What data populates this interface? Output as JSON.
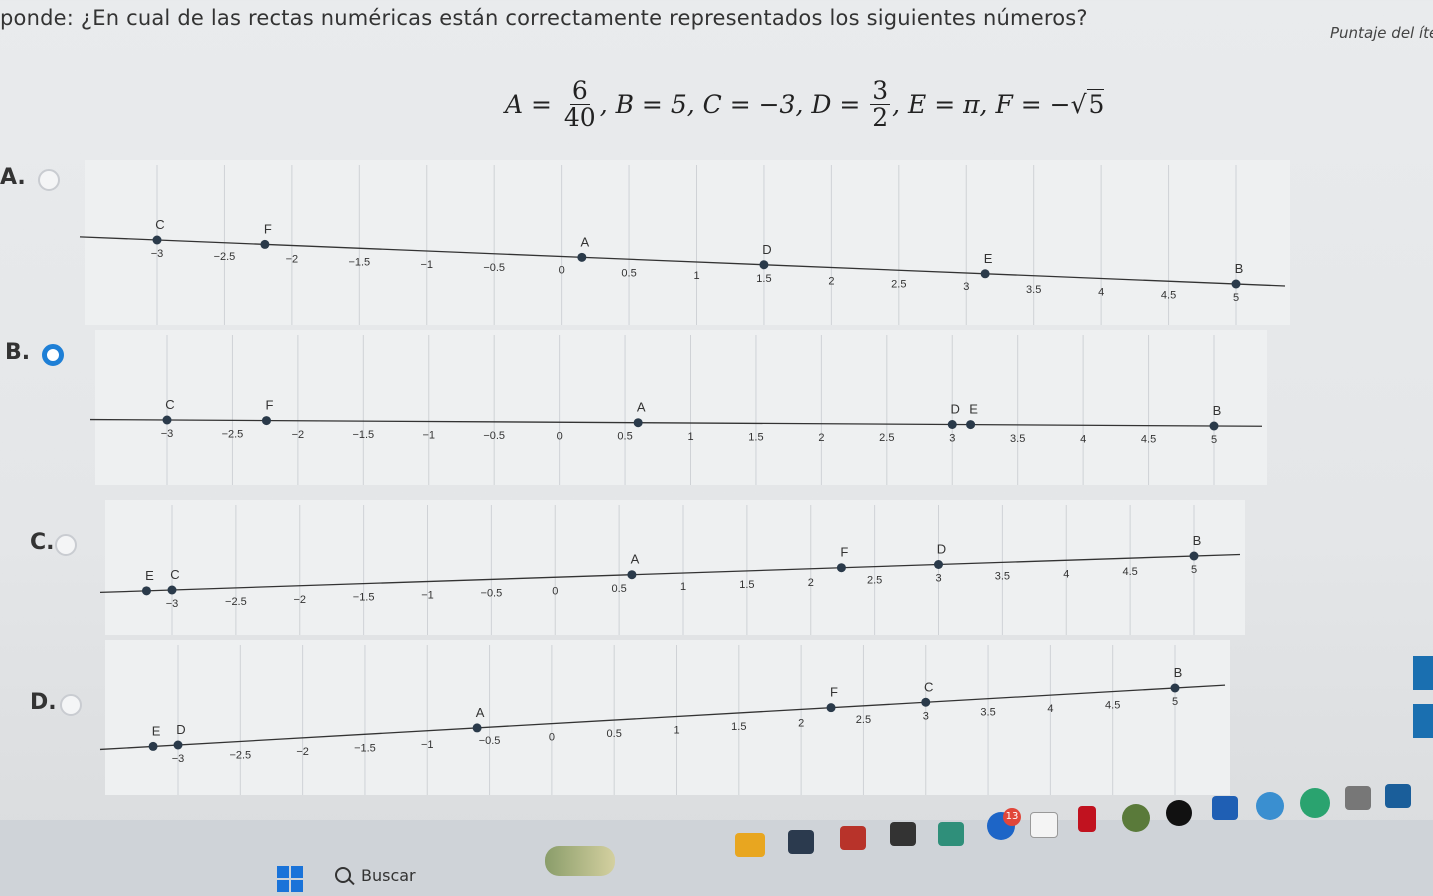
{
  "question": {
    "prefix": "ponde:",
    "text": "¿En cual de las rectas numéricas están correctamente representados los siguientes números?",
    "score_label": "Puntaje del íte"
  },
  "formula": {
    "A_lhs": "A =",
    "A_num": "6",
    "A_den": "40",
    "B": ", B = 5, C = −3, D =",
    "D_num": "3",
    "D_den": "2",
    "E": ", E = π, F = −",
    "F_rad": "5"
  },
  "ticks": [
    "−3",
    "−2.5",
    "−2",
    "−1.5",
    "−1",
    "−0.5",
    "0",
    "0.5",
    "1",
    "1.5",
    "2",
    "2.5",
    "3",
    "3.5",
    "4",
    "4.5",
    "5"
  ],
  "options": [
    {
      "label": "A.",
      "selected": false,
      "points": [
        {
          "name": "C",
          "value": -3
        },
        {
          "name": "F",
          "value": -2.2
        },
        {
          "name": "A",
          "value": 0.15
        },
        {
          "name": "D",
          "value": 1.5
        },
        {
          "name": "E",
          "value": 3.14
        },
        {
          "name": "B",
          "value": 5
        }
      ]
    },
    {
      "label": "B.",
      "selected": true,
      "points": [
        {
          "name": "C",
          "value": -3
        },
        {
          "name": "F",
          "value": -2.24
        },
        {
          "name": "A",
          "value": 0.6
        },
        {
          "name": "D",
          "value": 3
        },
        {
          "name": "E",
          "value": 3.14
        },
        {
          "name": "B",
          "value": 5
        }
      ]
    },
    {
      "label": "C.",
      "selected": false,
      "points": [
        {
          "name": "E",
          "value": -3.2
        },
        {
          "name": "C",
          "value": -3
        },
        {
          "name": "A",
          "value": 0.6
        },
        {
          "name": "F",
          "value": 2.24
        },
        {
          "name": "D",
          "value": 3
        },
        {
          "name": "B",
          "value": 5
        }
      ]
    },
    {
      "label": "D.",
      "selected": false,
      "points": [
        {
          "name": "E",
          "value": -3.2
        },
        {
          "name": "D",
          "value": -3
        },
        {
          "name": "A",
          "value": -0.6
        },
        {
          "name": "F",
          "value": 2.24
        },
        {
          "name": "C",
          "value": 3
        },
        {
          "name": "B",
          "value": 5
        }
      ]
    }
  ],
  "taskbar": {
    "search_placeholder": "Buscar",
    "notification_count": "13"
  }
}
